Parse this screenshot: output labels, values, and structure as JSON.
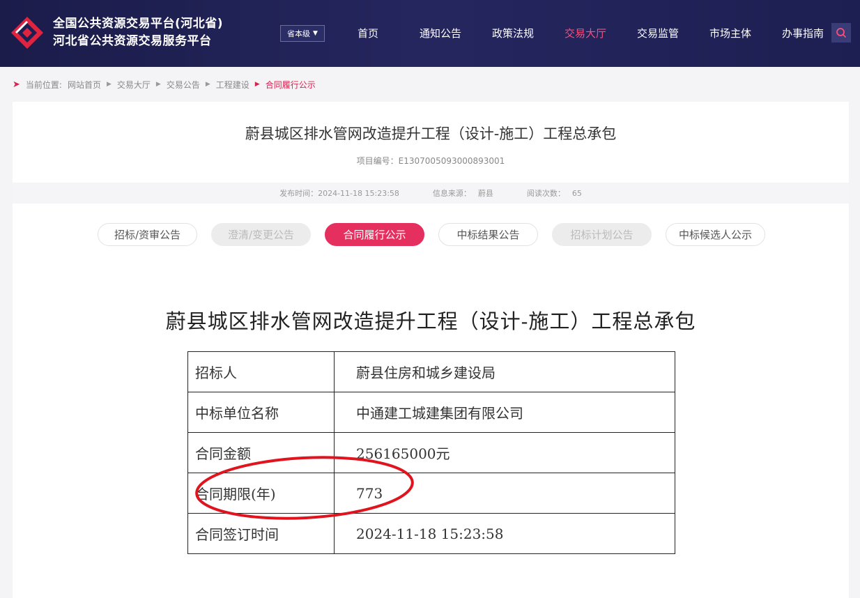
{
  "header": {
    "title_line1": "全国公共资源交易平台(河北省)",
    "title_line2": "河北省公共资源交易服务平台",
    "level_select": "省本级",
    "nav": [
      {
        "label": "首页",
        "active": false
      },
      {
        "label": "通知公告",
        "active": false
      },
      {
        "label": "政策法规",
        "active": false
      },
      {
        "label": "交易大厅",
        "active": true
      },
      {
        "label": "交易监管",
        "active": false
      },
      {
        "label": "市场主体",
        "active": false
      },
      {
        "label": "办事指南",
        "active": false
      }
    ],
    "accent_color": "#ff4d7a"
  },
  "breadcrumb": {
    "prefix": "当前位置:",
    "items": [
      "网站首页",
      "交易大厅",
      "交易公告",
      "工程建设"
    ],
    "current": "合同履行公示"
  },
  "detail": {
    "title": "蔚县城区排水管网改造提升工程（设计-施工）工程总承包",
    "project_no": "项目编号：E1307005093000893001",
    "publish_label": "发布时间：",
    "publish_time": "2024-11-18 15:23:58",
    "source_label": "信息来源：",
    "source": "蔚县",
    "views_label": "阅读次数：",
    "views": "65"
  },
  "tabs": [
    {
      "label": "招标/资审公告",
      "state": "normal"
    },
    {
      "label": "澄清/变更公告",
      "state": "disabled"
    },
    {
      "label": "合同履行公示",
      "state": "active"
    },
    {
      "label": "中标结果公告",
      "state": "normal"
    },
    {
      "label": "招标计划公告",
      "state": "disabled"
    },
    {
      "label": "中标候选人公示",
      "state": "normal"
    }
  ],
  "document": {
    "title": "蔚县城区排水管网改造提升工程（设计-施工）工程总承包",
    "rows": [
      {
        "key": "招标人",
        "value": "蔚县住房和城乡建设局"
      },
      {
        "key": "中标单位名称",
        "value": "中通建工城建集团有限公司"
      },
      {
        "key": "合同金额",
        "value": "256165000元"
      },
      {
        "key": "合同期限(年)",
        "value": "773"
      },
      {
        "key": "合同签订时间",
        "value": "2024-11-18 15:23:58"
      }
    ]
  },
  "colors": {
    "header_bg": "#1d1f52",
    "tab_active": "#e52f5e",
    "annotation": "#e0141e"
  },
  "icons": {
    "logo": "diamond-logo-icon",
    "search": "search-icon",
    "breadcrumb": "location-arrow-icon"
  }
}
